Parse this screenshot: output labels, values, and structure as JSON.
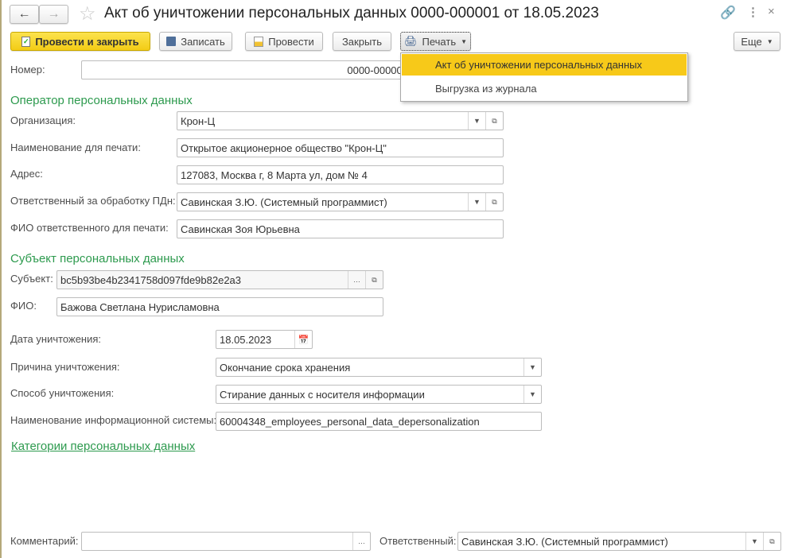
{
  "title": "Акт об уничтожении персональных данных 0000-000001 от 18.05.2023",
  "toolbar": {
    "post_close": "Провести и закрыть",
    "save": "Записать",
    "post": "Провести",
    "close": "Закрыть",
    "print": "Печать",
    "more": "Еще"
  },
  "print_menu": [
    "Акт об уничтожении персональных данных",
    "Выгрузка из журнала"
  ],
  "number": {
    "label": "Номер:",
    "value": "0000-000001"
  },
  "operator": {
    "header": "Оператор персональных данных",
    "org_label": "Организация:",
    "org": "Крон-Ц",
    "print_name_label": "Наименование для печати:",
    "print_name": "Открытое акционерное общество \"Крон-Ц\"",
    "address_label": "Адрес:",
    "address": "127083, Москва г, 8 Марта ул, дом № 4",
    "resp_label": "Ответственный за обработку ПДн:",
    "resp": "Савинская З.Ю. (Системный программист)",
    "resp_fio_label": "ФИО ответственного для печати:",
    "resp_fio": "Савинская Зоя Юрьевна"
  },
  "subject": {
    "header": "Субъект персональных данных",
    "subject_label": "Субъект:",
    "subject": "bc5b93be4b2341758d097fde9b82e2a3",
    "fio_label": "ФИО:",
    "fio": "Бажова Светлана Нурисламовна"
  },
  "destruction": {
    "date_label": "Дата уничтожения:",
    "date": "18.05.2023",
    "reason_label": "Причина уничтожения:",
    "reason": "Окончание срока хранения",
    "method_label": "Способ уничтожения:",
    "method": "Стирание данных с носителя информации",
    "system_label": "Наименование информационной системы:",
    "system": "60004348_employees_personal_data_depersonalization"
  },
  "categories_link": "Категории персональных данных",
  "footer": {
    "comment_label": "Комментарий:",
    "comment": "",
    "responsible_label": "Ответственный:",
    "responsible": "Савинская З.Ю. (Системный программист)"
  }
}
